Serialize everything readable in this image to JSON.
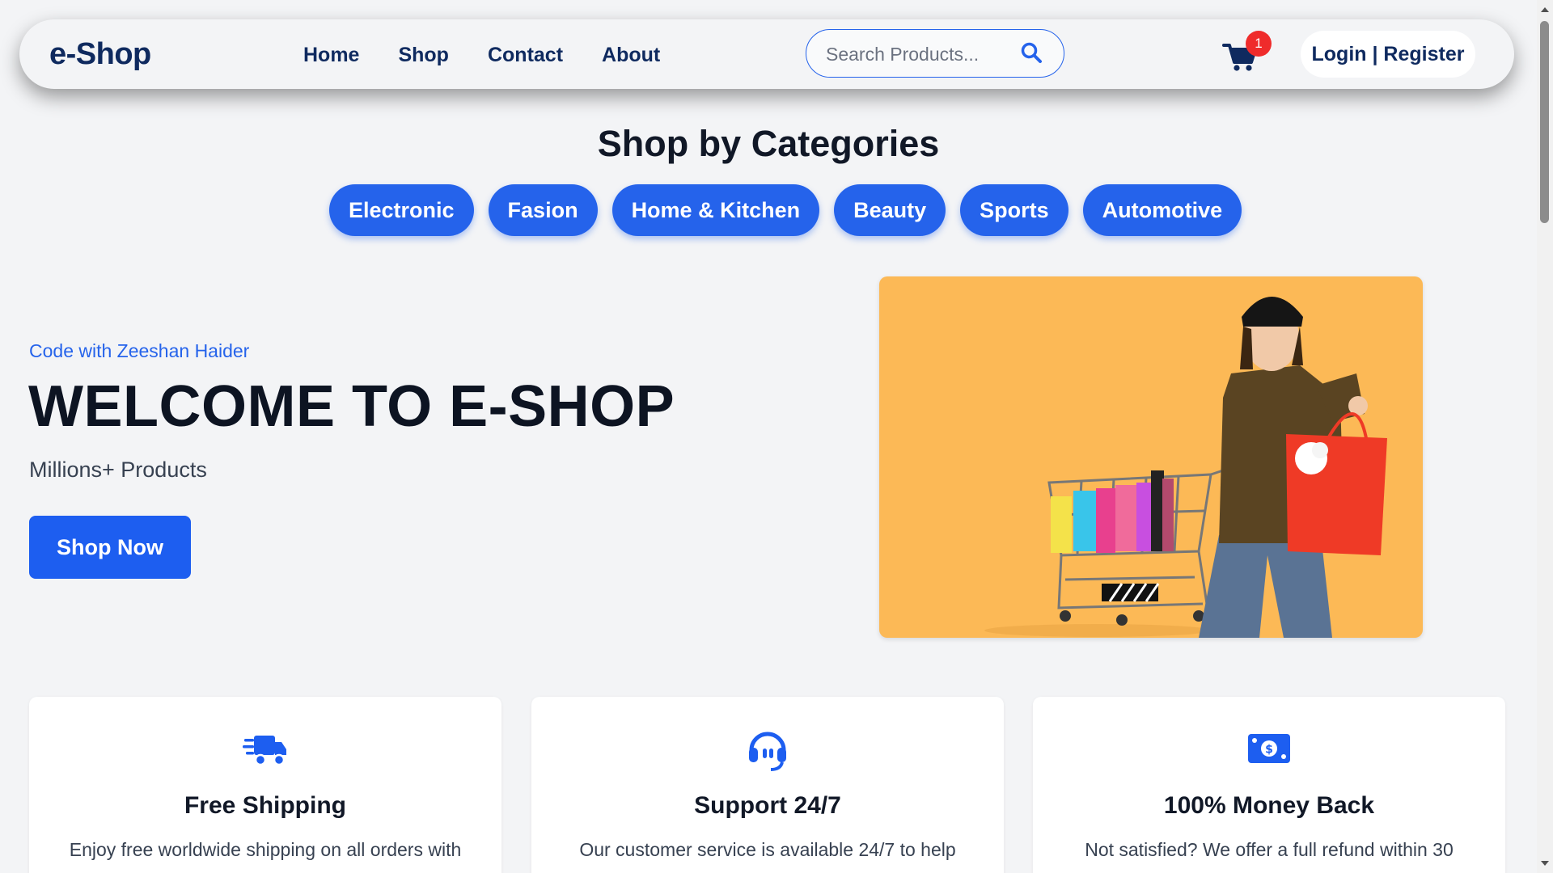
{
  "brand": "e-Shop",
  "nav": {
    "links": [
      "Home",
      "Shop",
      "Contact",
      "About"
    ]
  },
  "search": {
    "placeholder": "Search Products...",
    "icon": "search-icon"
  },
  "cart": {
    "icon": "cart-icon",
    "count": "1"
  },
  "auth_label": "Login | Register",
  "categories": {
    "title": "Shop by Categories",
    "items": [
      "Electronic",
      "Fasion",
      "Home & Kitchen",
      "Beauty",
      "Sports",
      "Automotive"
    ]
  },
  "hero": {
    "subtitle": "Code with Zeeshan Haider",
    "title": "WELCOME TO E-SHOP",
    "description": "Millions+ Products",
    "button": "Shop Now"
  },
  "features": [
    {
      "icon": "truck-icon",
      "title": "Free Shipping",
      "text": "Enjoy free worldwide shipping on all orders with"
    },
    {
      "icon": "headset-icon",
      "title": "Support 24/7",
      "text": "Our customer service is available 24/7 to help"
    },
    {
      "icon": "money-icon",
      "title": "100% Money Back",
      "text": "Not satisfied? We offer a full refund within 30"
    }
  ],
  "colors": {
    "accent": "#2563eb",
    "brand": "#0f2a5f",
    "hero_bg": "#fcb956",
    "badge": "#ef2b2b"
  }
}
